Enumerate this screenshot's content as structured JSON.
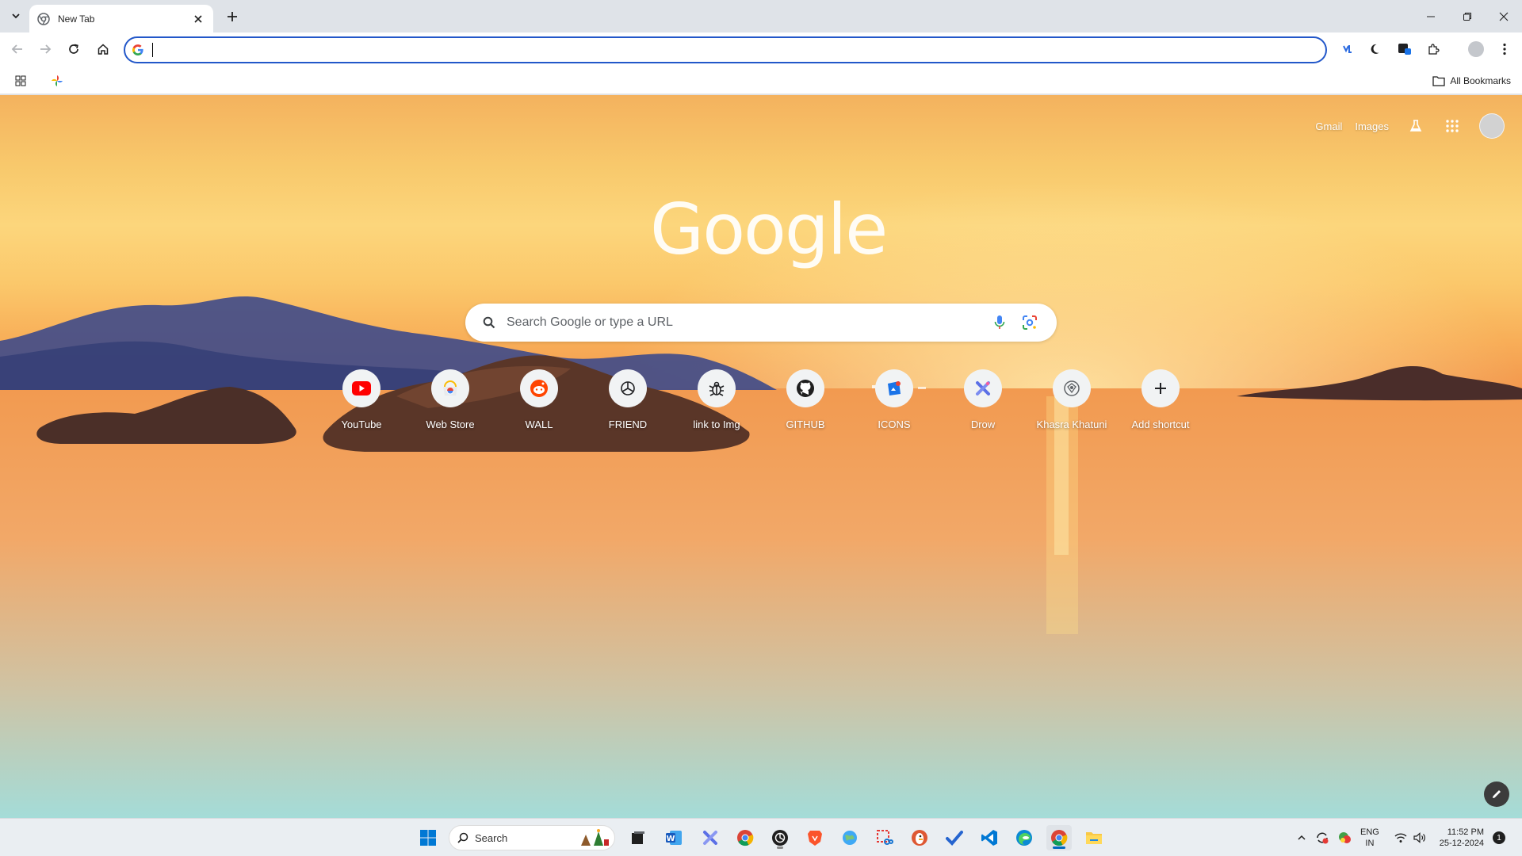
{
  "browser": {
    "tab": {
      "title": "New Tab"
    },
    "omnibox": {
      "value": "",
      "placeholder": ""
    },
    "bookmarks_bar": {
      "all_bookmarks_label": "All Bookmarks"
    }
  },
  "ntp": {
    "top_links": {
      "gmail": "Gmail",
      "images": "Images"
    },
    "logo_text": "Google",
    "search": {
      "placeholder": "Search Google or type a URL"
    },
    "shortcuts": [
      {
        "label": "YouTube",
        "icon": "youtube-icon"
      },
      {
        "label": "Web Store",
        "icon": "chrome-web-store-icon"
      },
      {
        "label": "WALL",
        "icon": "reddit-icon"
      },
      {
        "label": "FRIEND",
        "icon": "openai-icon"
      },
      {
        "label": "link to Img",
        "icon": "bug-icon"
      },
      {
        "label": "GITHUB",
        "icon": "github-icon"
      },
      {
        "label": "ICONS",
        "icon": "icons-app-icon"
      },
      {
        "label": "Drow",
        "icon": "draw-tool-icon"
      },
      {
        "label": "Khasra Khatuni",
        "icon": "emblem-icon"
      },
      {
        "label": "Add shortcut",
        "icon": "plus-icon"
      }
    ]
  },
  "taskbar": {
    "search_label": "Search",
    "language": {
      "line1": "ENG",
      "line2": "IN"
    },
    "clock": {
      "time": "11:52 PM",
      "date": "25-12-2024"
    },
    "notification_count": "1"
  },
  "colors": {
    "accent_blue": "#2257c9",
    "tab_strip": "#dfe3e8",
    "taskbar": "#eaeef2"
  }
}
